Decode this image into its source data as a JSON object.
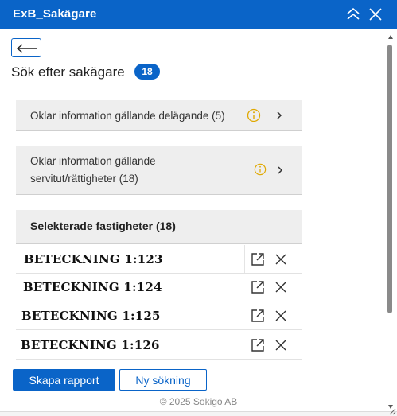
{
  "window": {
    "title": "ExB_Sakägare",
    "collapse_icon": "double-chevron-up-icon",
    "close_icon": "close-icon",
    "accent_color": "#0a64c8"
  },
  "nav": {
    "back_icon": "arrow-left-icon"
  },
  "page": {
    "heading": "Sök efter sakägare",
    "count": "18"
  },
  "info_rows": [
    {
      "label": "Oklar information gällande delägande (5)"
    },
    {
      "label_line1": "Oklar information gällande",
      "label_line2": "servitut/rättigheter (18)"
    }
  ],
  "selected": {
    "header": "Selekterade fastigheter (18)",
    "rows": [
      {
        "name": "BETECKNING 1:123"
      },
      {
        "name": "BETECKNING 1:124"
      },
      {
        "name": "BETECKNING 1:125"
      },
      {
        "name": "BETECKNING 1:126"
      }
    ]
  },
  "actions": {
    "create_report": "Skapa rapport",
    "new_search": "Ny sökning"
  },
  "footer": {
    "copyright": "© 2025 Sokigo AB"
  }
}
